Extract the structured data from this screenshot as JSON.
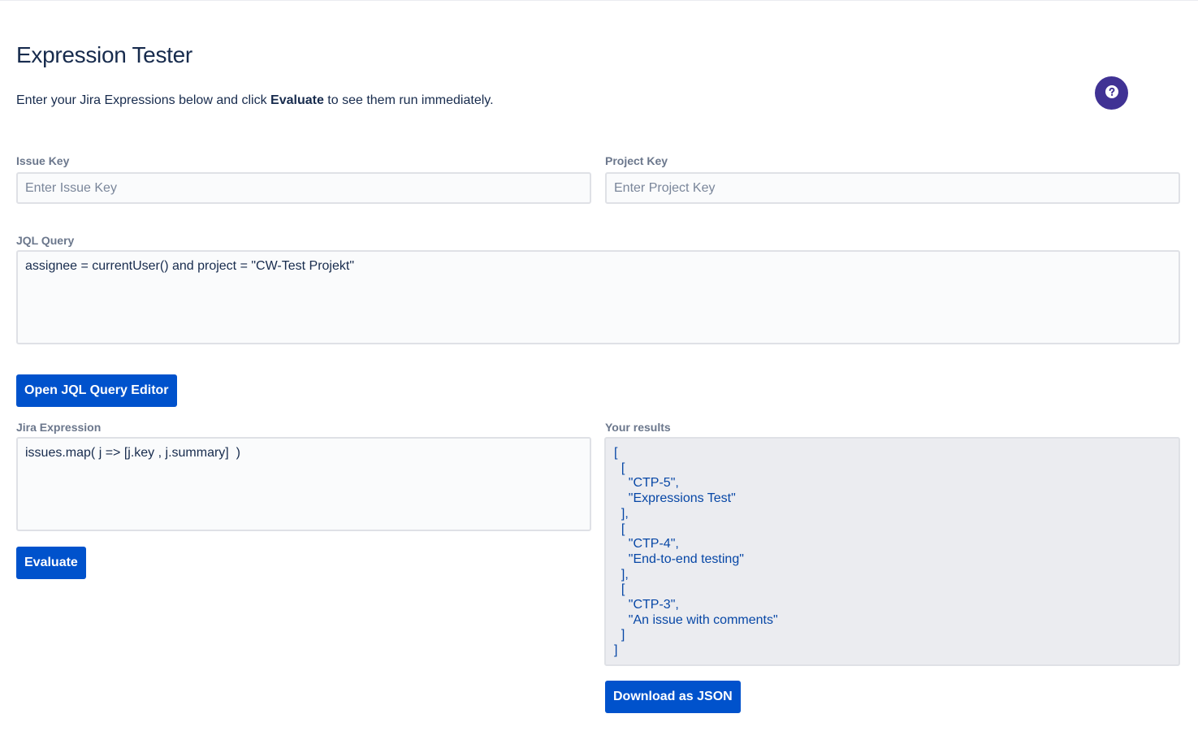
{
  "page": {
    "title": "Expression Tester",
    "intro_prefix": "Enter your Jira Expressions below and click ",
    "intro_bold": "Evaluate",
    "intro_suffix": " to see them run immediately.",
    "help_icon": "question-circle-icon"
  },
  "issue_key": {
    "label": "Issue Key",
    "placeholder": "Enter Issue Key",
    "value": ""
  },
  "project_key": {
    "label": "Project Key",
    "placeholder": "Enter Project Key",
    "value": ""
  },
  "jql": {
    "label": "JQL Query",
    "value": "assignee = currentUser() and project = \"CW-Test Projekt\"",
    "editor_button_label": "Open JQL Query Editor"
  },
  "expression": {
    "label": "Jira Expression",
    "value": "issues.map( j => [j.key , j.summary]  )",
    "evaluate_button_label": "Evaluate"
  },
  "results": {
    "label": "Your results",
    "text": "[\n  [\n    \"CTP-5\",\n    \"Expressions Test\"\n  ],\n  [\n    \"CTP-4\",\n    \"End-to-end testing\"\n  ],\n  [\n    \"CTP-3\",\n    \"An issue with comments\"\n  ]\n]",
    "download_button_label": "Download as JSON"
  },
  "colors": {
    "primary": "#0052CC",
    "help_button": "#403294",
    "heading": "#172B4D",
    "label": "#6B778C",
    "results_text": "#0747A6",
    "results_background": "#EBECF0"
  }
}
